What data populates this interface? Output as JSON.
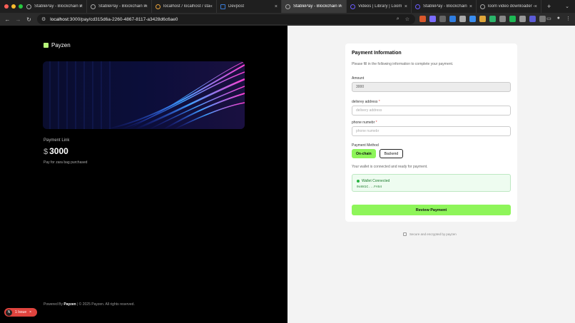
{
  "browser": {
    "tabs": [
      {
        "label": "StablePay - Blockchain P",
        "active": false
      },
      {
        "label": "StablePay - Blockchain P",
        "active": false
      },
      {
        "label": "localhost / localhost / sta",
        "active": false
      },
      {
        "label": "Devpost",
        "active": false
      },
      {
        "label": "StablePay - Blockchain P",
        "active": true
      },
      {
        "label": "Videos | Library | Loom",
        "active": false
      },
      {
        "label": "StablePay - Blockchain",
        "active": false
      },
      {
        "label": "loom video downloader -",
        "active": false
      }
    ],
    "new_tab": "+",
    "url_host": "localhost",
    "url_path": ":3000/pay/cd315d6a-2260-4867-8117-a3428d6c6ae0"
  },
  "left": {
    "brand": "Payzen",
    "payment_link_label": "Payment Link",
    "currency_symbol": "$",
    "amount": "3000",
    "description": "Pay for zara bag purchased",
    "footer_prefix": "Powered By",
    "footer_brand": "Payzen",
    "footer_suffix": "| © 2025 Payzen. All rights reserved."
  },
  "issue_badge": {
    "initial": "N",
    "label": "1 Issue",
    "close": "×"
  },
  "form": {
    "title": "Payment Information",
    "subtitle": "Please fill in the following information to complete your payment.",
    "amount_label": "Amount",
    "amount_value": "3000",
    "address_label": "delivrey address",
    "address_placeholder": "delivery address",
    "phone_label": "phone numebr",
    "phone_placeholder": "phone numebr",
    "method_label": "Payment Method",
    "method_onchain": "On-chain",
    "method_backend": "Backend",
    "wallet_note": "Your wallet is connected and ready for payment.",
    "wallet_status": "Wallet Connected",
    "wallet_address": "0x881C...FA54",
    "review_button": "Review Payment",
    "secure_note": "Secure and encrypted by payzen"
  }
}
